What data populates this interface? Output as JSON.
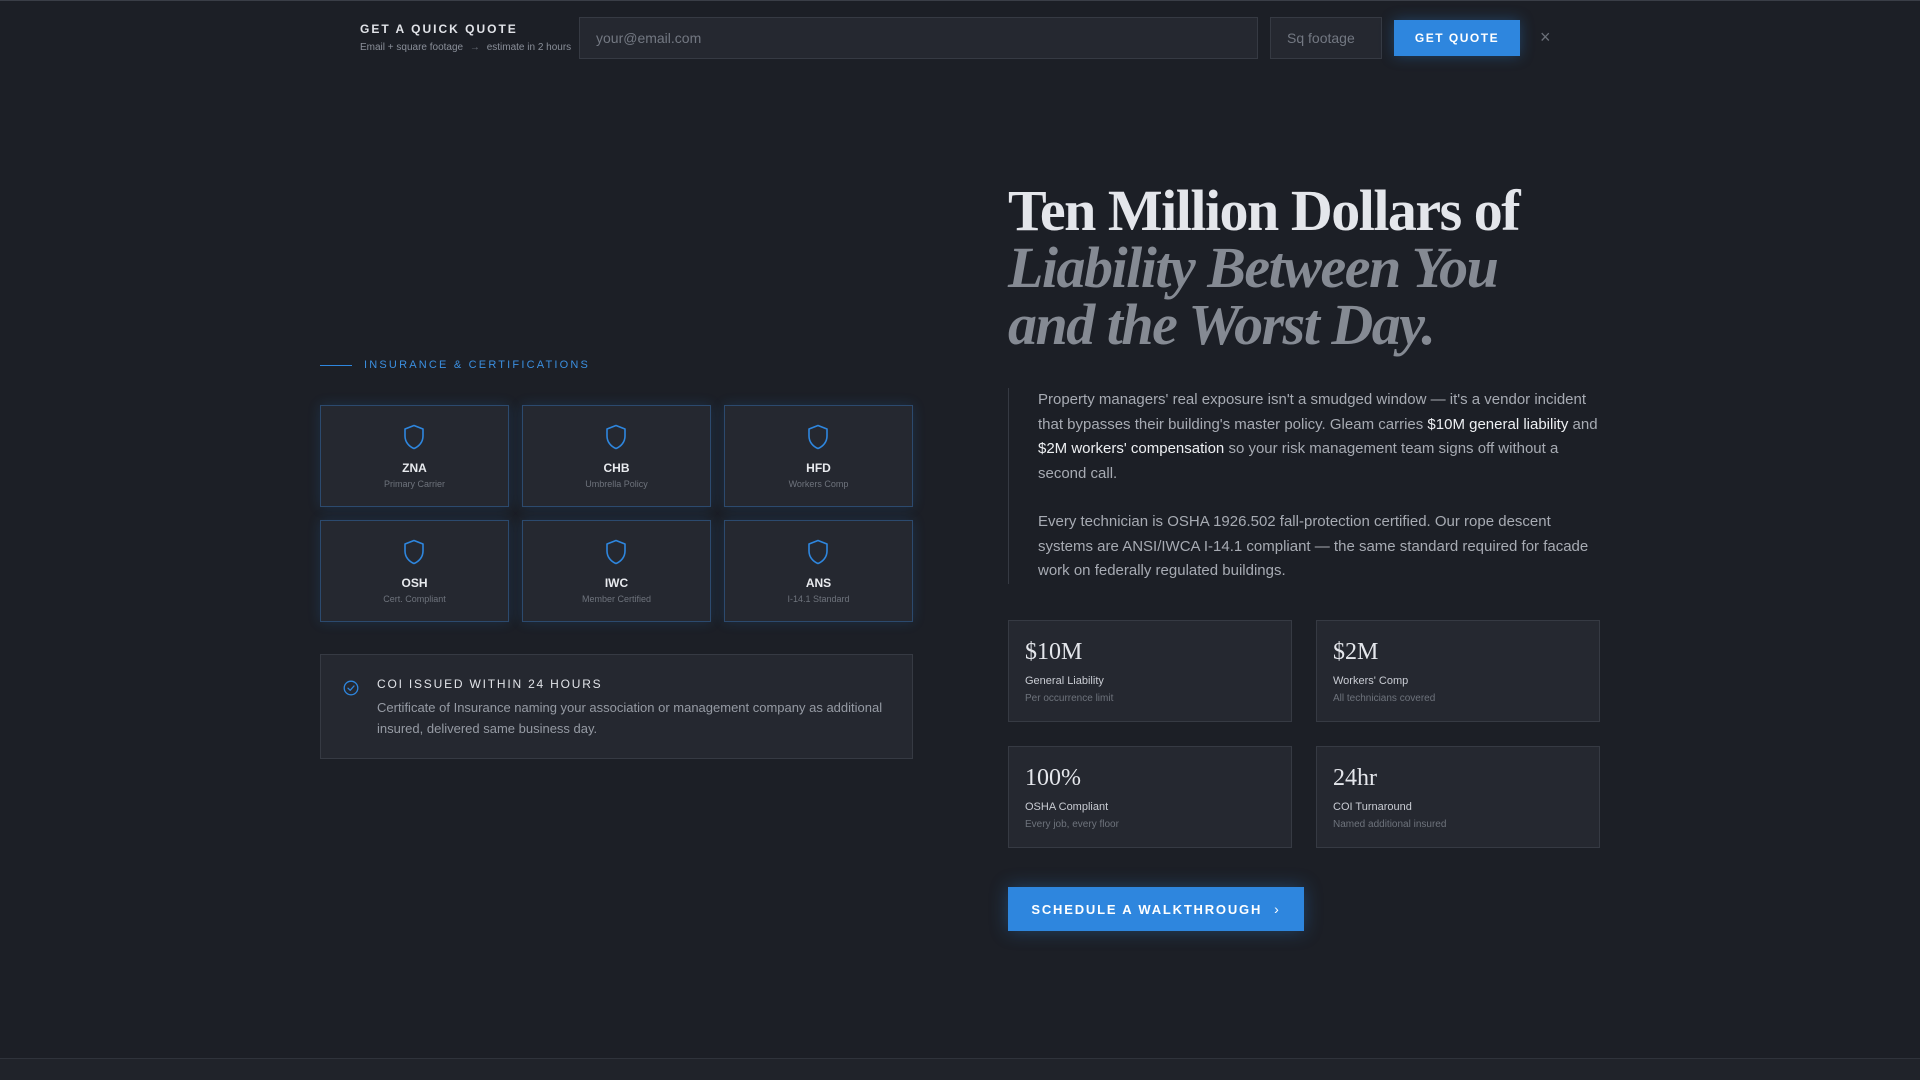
{
  "quote_bar": {
    "title": "GET A QUICK QUOTE",
    "subtitle_left": "Email + square footage",
    "subtitle_arrow": "→",
    "subtitle_right": "estimate in 2 hours",
    "email_placeholder": "your@email.com",
    "sqft_placeholder": "Sq footage",
    "button_label": "GET QUOTE",
    "close_glyph": "×"
  },
  "insurance": {
    "section_label": "INSURANCE & CERTIFICATIONS",
    "certs": [
      {
        "code": "ZNA",
        "desc": "Primary Carrier"
      },
      {
        "code": "CHB",
        "desc": "Umbrella Policy"
      },
      {
        "code": "HFD",
        "desc": "Workers Comp"
      },
      {
        "code": "OSH",
        "desc": "Cert. Compliant"
      },
      {
        "code": "IWC",
        "desc": "Member Certified"
      },
      {
        "code": "ANS",
        "desc": "I-14.1 Standard"
      }
    ],
    "coi": {
      "title": "COI ISSUED WITHIN 24 HOURS",
      "text": "Certificate of Insurance naming your association or management company as additional insured, delivered same business day."
    }
  },
  "hero": {
    "headline_line1": "Ten Million Dollars of",
    "headline_line2": "Liability Between You",
    "headline_line3": "and the Worst Day.",
    "para1_a": "Property managers' real exposure isn't a smudged window — it's a vendor incident that bypasses their building's master policy. Gleam carries ",
    "para1_strong1": "$10M general liability",
    "para1_b": " and ",
    "para1_strong2": "$2M workers' compensation",
    "para1_c": " so your risk management team signs off without a second call.",
    "para2": "Every technician is OSHA 1926.502 fall-protection certified. Our rope descent systems are ANSI/IWCA I-14.1 compliant — the same standard required for facade work on federally regulated buildings."
  },
  "stats": [
    {
      "value": "$10M",
      "label": "General Liability",
      "sub": "Per occurrence limit"
    },
    {
      "value": "$2M",
      "label": "Workers' Comp",
      "sub": "All technicians covered"
    },
    {
      "value": "100%",
      "label": "OSHA Compliant",
      "sub": "Every job, every floor"
    },
    {
      "value": "24hr",
      "label": "COI Turnaround",
      "sub": "Named additional insured"
    }
  ],
  "cta": {
    "label": "SCHEDULE A WALKTHROUGH",
    "chevron": "›"
  },
  "colors": {
    "accent": "#2e86de",
    "background": "#1c1f26",
    "card": "#252830"
  }
}
